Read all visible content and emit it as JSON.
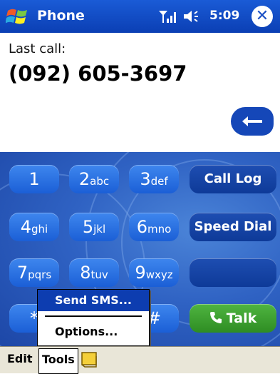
{
  "titlebar": {
    "title": "Phone",
    "time": "5:09",
    "close_label": "✕"
  },
  "display": {
    "last_call_label": "Last call:",
    "last_call_number": "(092) 605-3697"
  },
  "keypad": {
    "keys": [
      {
        "digit": "1",
        "letters": ""
      },
      {
        "digit": "2",
        "letters": "abc"
      },
      {
        "digit": "3",
        "letters": "def"
      },
      {
        "digit": "4",
        "letters": "ghi"
      },
      {
        "digit": "5",
        "letters": "jkl"
      },
      {
        "digit": "6",
        "letters": "mno"
      },
      {
        "digit": "7",
        "letters": "pqrs"
      },
      {
        "digit": "8",
        "letters": "tuv"
      },
      {
        "digit": "9",
        "letters": "wxyz"
      },
      {
        "digit": "*",
        "letters": ""
      },
      {
        "digit": "#",
        "letters": ""
      }
    ],
    "call_log": "Call Log",
    "speed_dial": "Speed Dial",
    "talk": "Talk"
  },
  "menu": {
    "send_sms": "Send SMS...",
    "options": "Options..."
  },
  "menubar": {
    "edit": "Edit",
    "tools": "Tools"
  },
  "colors": {
    "title_blue": "#1a5bd6",
    "key_blue": "#2f7ae6",
    "talk_green": "#3da634",
    "menu_highlight": "#0d3db0"
  },
  "icons": {
    "logo": "windows-flag-icon",
    "signal": "signal-strength-icon",
    "speaker": "speaker-icon",
    "close": "close-icon",
    "backspace": "backspace-arrow-icon",
    "talk": "phone-handset-icon",
    "keyboard": "keyboard-icon"
  }
}
